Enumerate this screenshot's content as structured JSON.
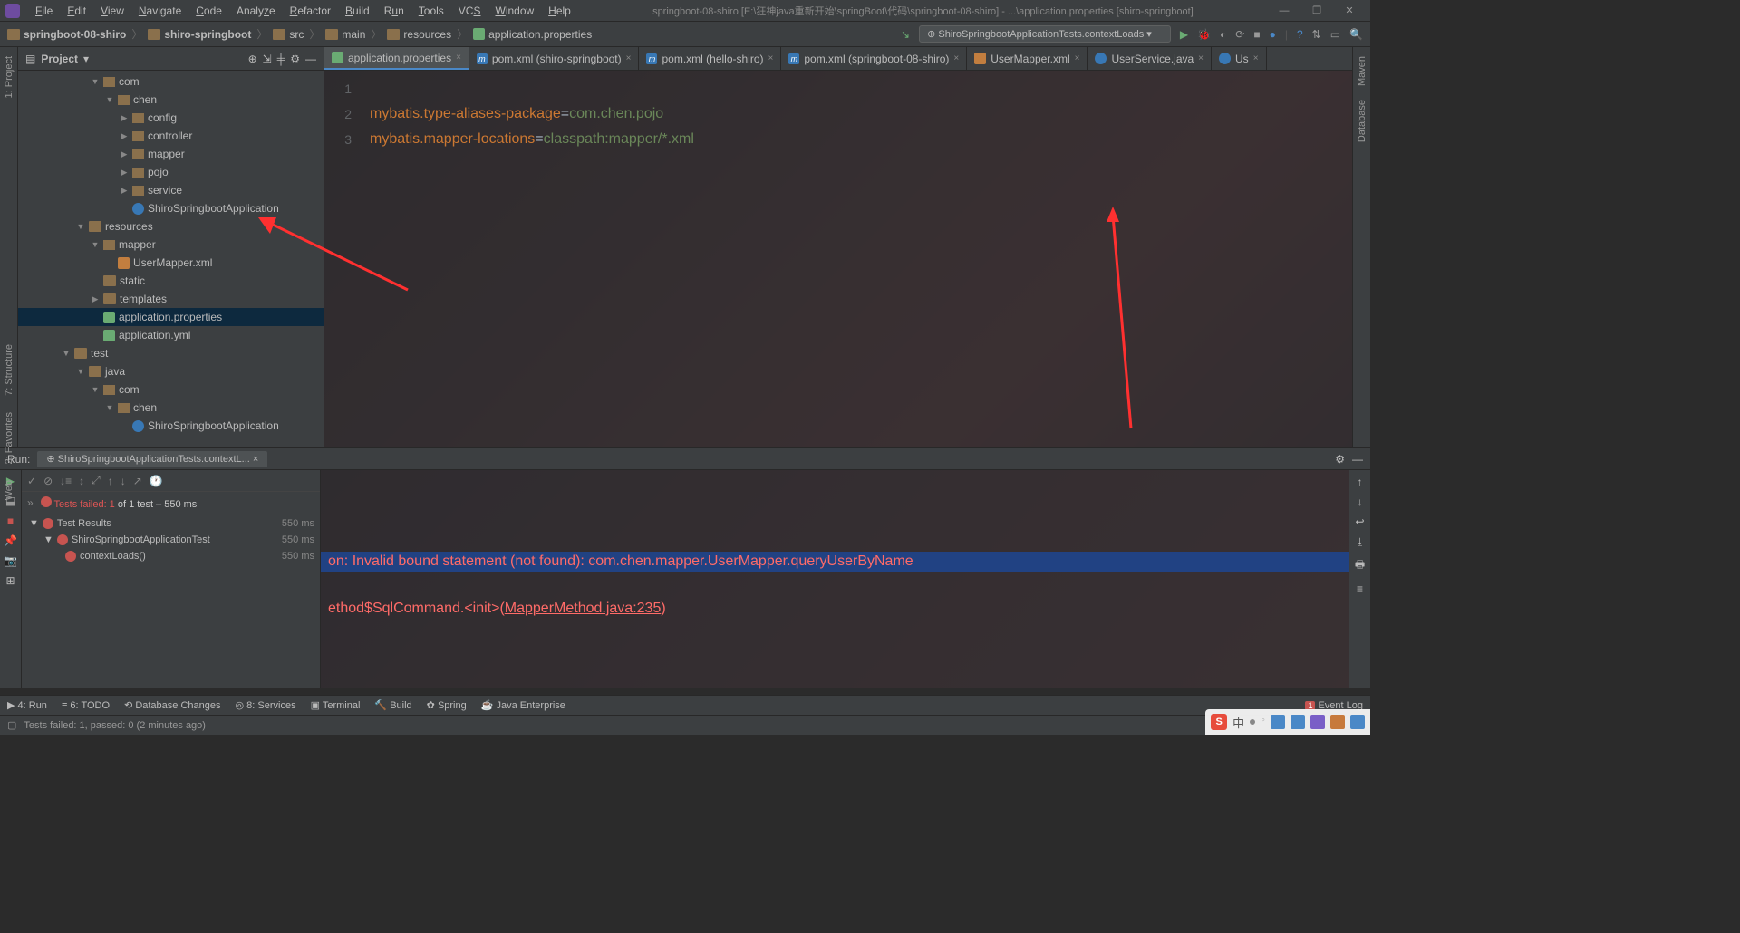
{
  "menubar": {
    "items": [
      "File",
      "Edit",
      "View",
      "Navigate",
      "Code",
      "Analyze",
      "Refactor",
      "Build",
      "Run",
      "Tools",
      "VCS",
      "Window",
      "Help"
    ],
    "title": "springboot-08-shiro [E:\\狂神java重新开始\\springBoot\\代码\\springboot-08-shiro] - ...\\application.properties [shiro-springboot]"
  },
  "breadcrumbs": [
    "springboot-08-shiro",
    "shiro-springboot",
    "src",
    "main",
    "resources",
    "application.properties"
  ],
  "runconfig": "ShiroSpringbootApplicationTests.contextLoads",
  "project_panel_title": "Project",
  "tree": [
    {
      "indent": 5,
      "arrow": "▼",
      "icon": "pkg",
      "label": "com"
    },
    {
      "indent": 6,
      "arrow": "▼",
      "icon": "pkg",
      "label": "chen"
    },
    {
      "indent": 7,
      "arrow": "▶",
      "icon": "pkg",
      "label": "config"
    },
    {
      "indent": 7,
      "arrow": "▶",
      "icon": "pkg",
      "label": "controller"
    },
    {
      "indent": 7,
      "arrow": "▶",
      "icon": "pkg",
      "label": "mapper"
    },
    {
      "indent": 7,
      "arrow": "▶",
      "icon": "pkg",
      "label": "pojo"
    },
    {
      "indent": 7,
      "arrow": "▶",
      "icon": "pkg",
      "label": "service"
    },
    {
      "indent": 7,
      "arrow": "",
      "icon": "cls",
      "label": "ShiroSpringbootApplication"
    },
    {
      "indent": 4,
      "arrow": "▼",
      "icon": "fld",
      "label": "resources"
    },
    {
      "indent": 5,
      "arrow": "▼",
      "icon": "pkg",
      "label": "mapper"
    },
    {
      "indent": 6,
      "arrow": "",
      "icon": "xml",
      "label": "UserMapper.xml"
    },
    {
      "indent": 5,
      "arrow": "",
      "icon": "fld",
      "label": "static"
    },
    {
      "indent": 5,
      "arrow": "▶",
      "icon": "fld",
      "label": "templates"
    },
    {
      "indent": 5,
      "arrow": "",
      "icon": "file",
      "label": "application.properties",
      "sel": true
    },
    {
      "indent": 5,
      "arrow": "",
      "icon": "file",
      "label": "application.yml"
    },
    {
      "indent": 3,
      "arrow": "▼",
      "icon": "fld",
      "label": "test"
    },
    {
      "indent": 4,
      "arrow": "▼",
      "icon": "fld",
      "label": "java"
    },
    {
      "indent": 5,
      "arrow": "▼",
      "icon": "pkg",
      "label": "com"
    },
    {
      "indent": 6,
      "arrow": "▼",
      "icon": "pkg",
      "label": "chen"
    },
    {
      "indent": 7,
      "arrow": "",
      "icon": "cls",
      "label": "ShiroSpringbootApplication"
    }
  ],
  "tabs": [
    {
      "icon": "file",
      "label": "application.properties",
      "active": true
    },
    {
      "icon": "m",
      "label": "pom.xml (shiro-springboot)"
    },
    {
      "icon": "m",
      "label": "pom.xml (hello-shiro)"
    },
    {
      "icon": "m",
      "label": "pom.xml (springboot-08-shiro)"
    },
    {
      "icon": "xml",
      "label": "UserMapper.xml"
    },
    {
      "icon": "cls",
      "label": "UserService.java"
    },
    {
      "icon": "cls",
      "label": "Us"
    }
  ],
  "code": {
    "line1_num": "1",
    "line2_num": "2",
    "line2_k": "mybatis.type-aliases-package",
    "line2_v": "com.chen.pojo",
    "line3_num": "3",
    "line3_k": "mybatis.mapper-locations",
    "line3_v": "classpath:mapper/*.xml"
  },
  "leftbars": [
    "1: Project"
  ],
  "leftbars2": [
    "7: Structure",
    "2: Favorites",
    "Web"
  ],
  "rightbars": [
    "Maven",
    "Database"
  ],
  "run": {
    "label": "Run:",
    "tab": "ShiroSpringbootApplicationTests.contextL...",
    "fail_pre": "Tests failed: 1",
    "fail_post": " of 1 test – 550 ms",
    "results_label": "Test Results",
    "results_ms": "550 ms",
    "test_class": "ShiroSpringbootApplicationTest",
    "test_class_ms": "550 ms",
    "test_method": "contextLoads()",
    "test_method_ms": "550 ms"
  },
  "console": {
    "errline": "on: Invalid bound statement (not found): com.chen.mapper.UserMapper.queryUserByName",
    "trace_a": "ethod$SqlCommand.<init>(",
    "trace_link": "MapperMethod.java:235",
    "trace_b": ")"
  },
  "statusbar": {
    "items": [
      "4: Run",
      "6: TODO",
      "Database Changes",
      "8: Services",
      "Terminal",
      "Build",
      "Spring",
      "Java Enterprise"
    ],
    "eventlog": "Event Log",
    "eventcount": "1",
    "bottom": "Tests failed: 1, passed: 0 (2 minutes ago)"
  },
  "ime": {
    "label": "中"
  }
}
